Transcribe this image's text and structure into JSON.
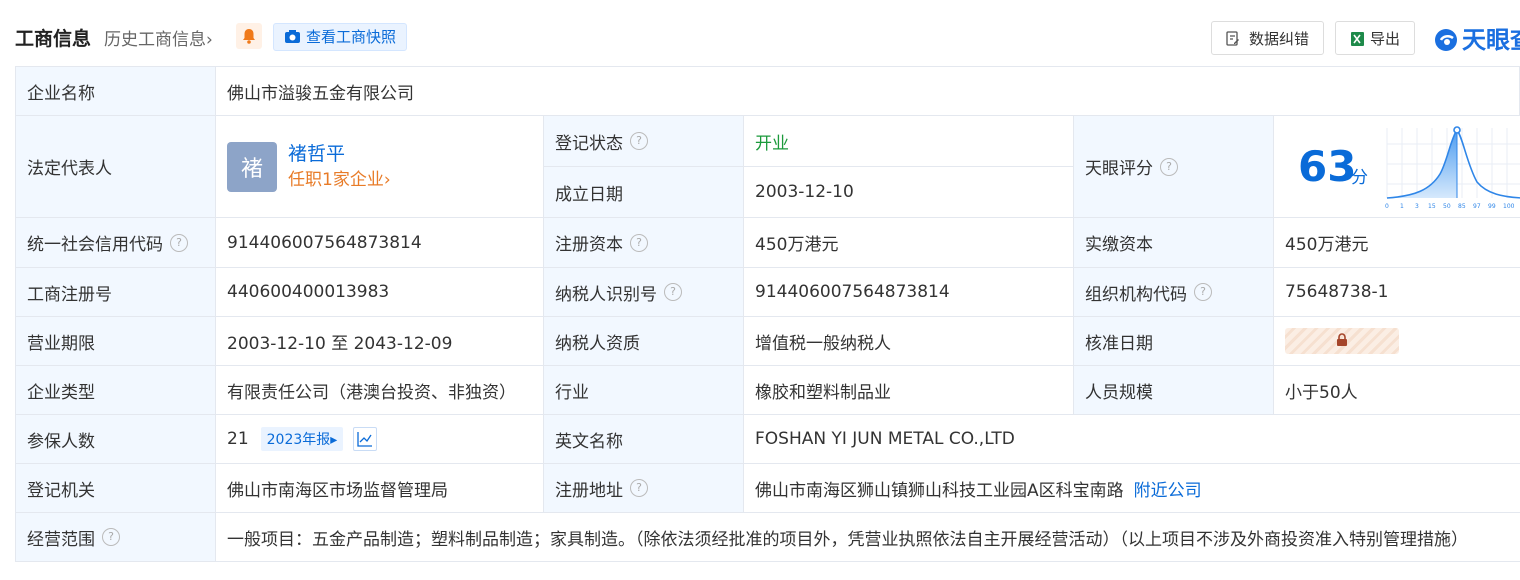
{
  "header": {
    "title": "工商信息",
    "history": "历史工商信息",
    "history_arrow": "›",
    "snapshot": "查看工商快照",
    "error_btn": "数据纠错",
    "export_btn": "导出",
    "logo_text": "天眼查"
  },
  "colors": {
    "accent": "#0a6bd8",
    "green": "#1b9a3b",
    "orange": "#e87b27",
    "label_bg": "#f2f8ff"
  },
  "rows": {
    "company_name": {
      "label": "企业名称",
      "value": "佛山市溢骏五金有限公司"
    },
    "legal_rep": {
      "label": "法定代表人",
      "avatar_char": "褚",
      "name": "褚哲平",
      "posts": "任职1家企业",
      "posts_arrow": "›"
    },
    "reg_status": {
      "label": "登记状态",
      "value": "开业"
    },
    "founded": {
      "label": "成立日期",
      "value": "2003-12-10"
    },
    "tianyan_score": {
      "label": "天眼评分",
      "score": "63",
      "unit": "分",
      "axis_ticks": [
        "0",
        "1",
        "3",
        "15",
        "50",
        "85",
        "97",
        "99",
        "100"
      ]
    },
    "credit_code": {
      "label": "统一社会信用代码",
      "value": "914406007564873814"
    },
    "reg_capital": {
      "label": "注册资本",
      "value": "450万港元"
    },
    "paid_capital": {
      "label": "实缴资本",
      "value": "450万港元"
    },
    "reg_number": {
      "label": "工商注册号",
      "value": "440600400013983"
    },
    "taxpayer_id": {
      "label": "纳税人识别号",
      "value": "914406007564873814"
    },
    "org_code": {
      "label": "组织机构代码",
      "value": "75648738-1"
    },
    "term": {
      "label": "营业期限",
      "value": "2003-12-10 至 2043-12-09"
    },
    "tax_quality": {
      "label": "纳税人资质",
      "value": "增值税一般纳税人"
    },
    "approve_date": {
      "label": "核准日期"
    },
    "company_type": {
      "label": "企业类型",
      "value": "有限责任公司（港澳台投资、非独资）"
    },
    "industry": {
      "label": "行业",
      "value": "橡胶和塑料制品业"
    },
    "staff_size": {
      "label": "人员规模",
      "value": "小于50人"
    },
    "insured": {
      "label": "参保人数",
      "value": "21",
      "report": "2023年报▸"
    },
    "english_name": {
      "label": "英文名称",
      "value": "FOSHAN YI JUN METAL CO.,LTD"
    },
    "reg_authority": {
      "label": "登记机关",
      "value": "佛山市南海区市场监督管理局"
    },
    "reg_address": {
      "label": "注册地址",
      "value": "佛山市南海区狮山镇狮山科技工业园A区科宝南路",
      "nearby": "附近公司"
    },
    "scope": {
      "label": "经营范围",
      "value": "一般项目：五金产品制造；塑料制品制造；家具制造。（除依法须经批准的项目外，凭营业执照依法自主开展经营活动）（以上项目不涉及外商投资准入特别管理措施）"
    }
  }
}
